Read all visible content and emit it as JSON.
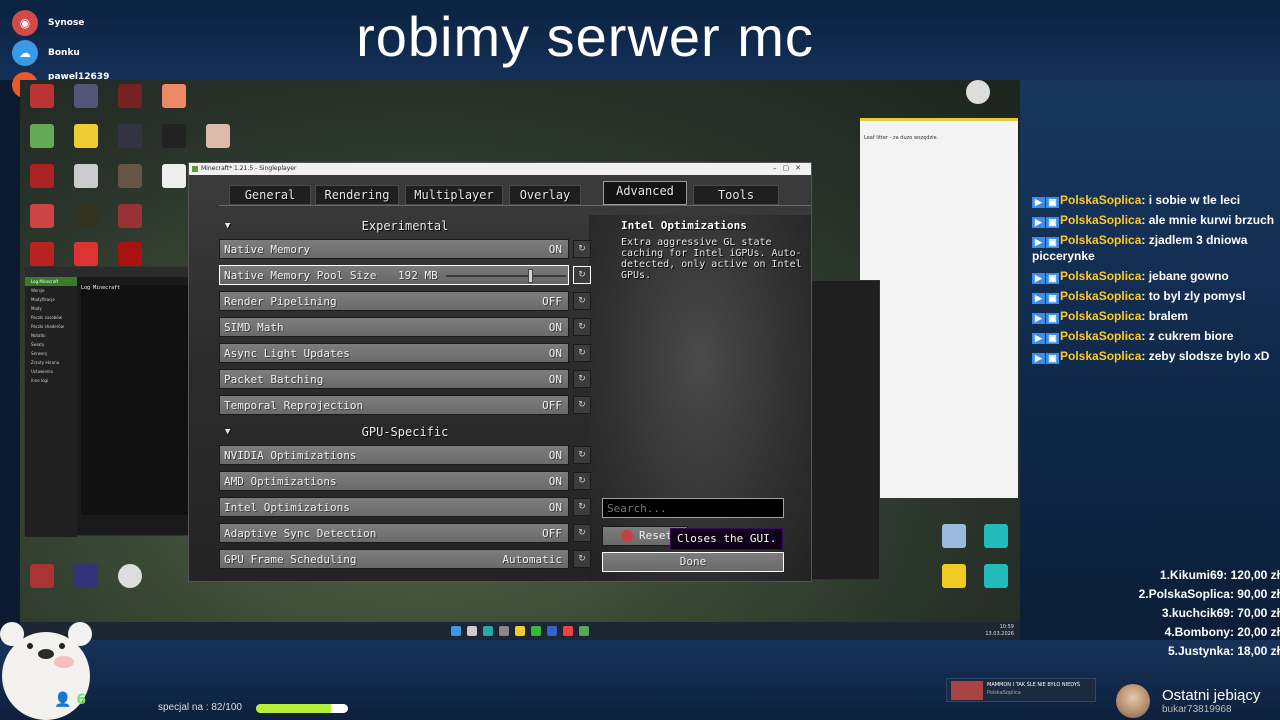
{
  "stream": {
    "title": "robimy serwer mc",
    "socials": [
      {
        "label": "Synose",
        "color": "#d24a4a"
      },
      {
        "label": "Bonku",
        "color": "#3a9ae8"
      },
      {
        "label": "pawel12639",
        "color": "#e85a2a"
      }
    ],
    "goal_label": "specjal na : 82/100",
    "goal_progress": 0.82,
    "viewers": "6",
    "alert_title": "MAMMON I TAK ŚLE NIE BYŁO NIEDYŚ",
    "alert_user": "PolskaSoplica",
    "last_sub_title": "Ostatni jebiący",
    "last_sub_user": "bukar73819968"
  },
  "chat": [
    {
      "user": "PolskaSoplica",
      "text": "i sobie w tle leci"
    },
    {
      "user": "PolskaSoplica",
      "text": "ale mnie kurwi brzuch"
    },
    {
      "user": "PolskaSoplica",
      "text": "zjadlem 3 dniowa picceryn​ke"
    },
    {
      "user": "PolskaSoplica",
      "text": "jebane gowno"
    },
    {
      "user": "PolskaSoplica",
      "text": "to byl zly pomysl"
    },
    {
      "user": "PolskaSoplica",
      "text": "bralem"
    },
    {
      "user": "PolskaSoplica",
      "text": "z cukrem biore"
    },
    {
      "user": "PolskaSoplica",
      "text": "zeby slodsze bylo xD"
    }
  ],
  "leaderboard": [
    "1.Kikumi69: 120,00 zł",
    "2.PolskaSoplica: 90,00 zł",
    "3.kuchcik69: 70,00 zł",
    "4.Bombony: 20,00 zł",
    "5.Justynka: 18,00 zł"
  ],
  "desktop": {
    "side_window_text": "Leaf litter - za duzo wszędzie.",
    "launcher_title": "Log Minecraft",
    "launcher_nav": [
      "Log Minecraft",
      "Wersje",
      "Modyfikacje",
      "Mody",
      "Paczki zasobów",
      "Paczki shaderów",
      "Notatki",
      "Światy",
      "Serwery",
      "Zrzuty ekranu",
      "Ustawienia",
      "Inne logi"
    ],
    "clock_time": "10:59",
    "clock_date": "13.03.2026"
  },
  "minecraft": {
    "window_title": "Minecraft* 1.21.5 - Singleplayer",
    "tabs": [
      "General",
      "Rendering",
      "Multiplayer",
      "Overlay",
      "Advanced",
      "Tools"
    ],
    "active_tab": "Advanced",
    "sections": [
      {
        "label": "Experimental",
        "rows": [
          {
            "name": "Native Memory",
            "value": "ON"
          },
          {
            "name": "Native Memory Pool Size",
            "value": "192 MB",
            "slider": 0.7
          },
          {
            "name": "Render Pipelining",
            "value": "OFF"
          },
          {
            "name": "SIMD Math",
            "value": "ON"
          },
          {
            "name": "Async Light Updates",
            "value": "ON"
          },
          {
            "name": "Packet Batching",
            "value": "ON"
          },
          {
            "name": "Temporal Reprojection",
            "value": "OFF"
          }
        ]
      },
      {
        "label": "GPU-Specific",
        "rows": [
          {
            "name": "NVIDIA Optimizations",
            "value": "ON"
          },
          {
            "name": "AMD Optimizations",
            "value": "ON"
          },
          {
            "name": "Intel Optimizations",
            "value": "ON"
          },
          {
            "name": "Adaptive Sync Detection",
            "value": "OFF"
          },
          {
            "name": "GPU Frame Scheduling",
            "value": "Automatic"
          }
        ]
      }
    ],
    "description_title": "Intel Optimizations",
    "description_body": "Extra aggressive GL state caching for Intel iGPUs. Auto-detected, only active on Intel GPUs.",
    "search_placeholder": "Search...",
    "reset_label": "Reset",
    "tooltip": "Closes the GUI.",
    "done_label": "Done"
  }
}
